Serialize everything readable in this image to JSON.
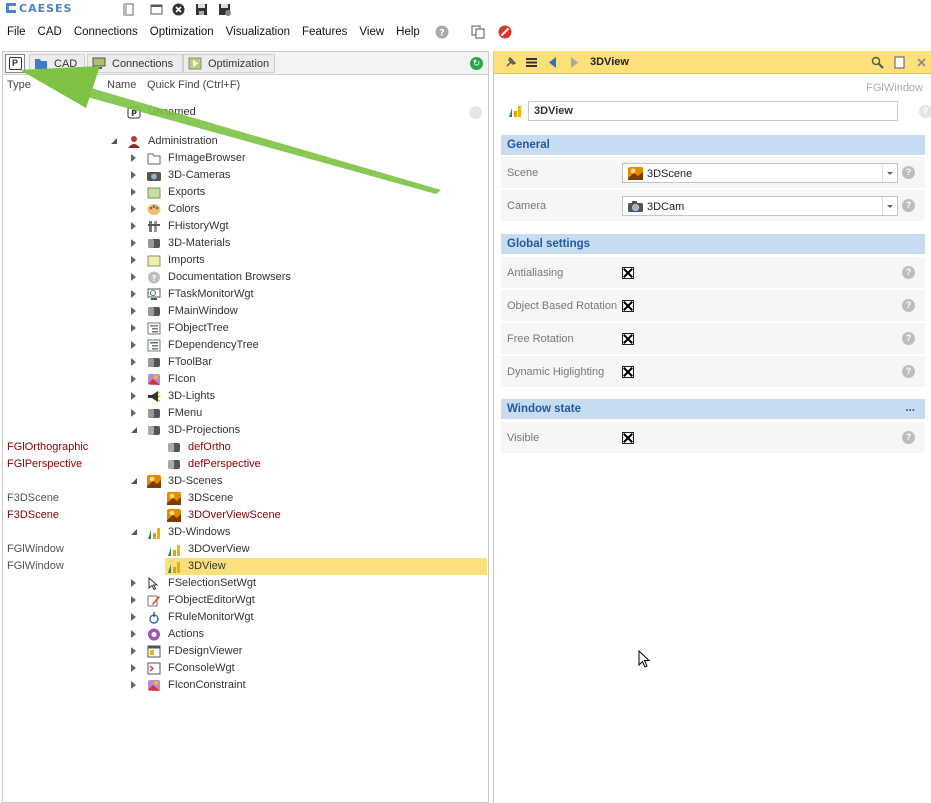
{
  "app": {
    "logo_text": "CAESES"
  },
  "menu": {
    "items": [
      "File",
      "CAD",
      "Connections",
      "Optimization",
      "Visualization",
      "Features",
      "View",
      "Help"
    ]
  },
  "left": {
    "tabs": [
      {
        "label": "P"
      },
      {
        "label": "CAD"
      },
      {
        "label": "Connections"
      },
      {
        "label": "Optimization"
      }
    ],
    "columns": {
      "type": "Type",
      "name": "Name",
      "find_placeholder": "Quick Find (Ctrl+F)"
    },
    "tree": [
      {
        "type": "",
        "label": "Unnamed",
        "level": 0,
        "exp": "none",
        "icon": "project-icon"
      },
      {
        "type": "",
        "label": "Administration",
        "level": 0,
        "exp": "open",
        "icon": "admin-icon"
      },
      {
        "type": "",
        "label": "FImageBrowser",
        "level": 1,
        "exp": "closed",
        "icon": "folder-icon"
      },
      {
        "type": "",
        "label": "3D-Cameras",
        "level": 1,
        "exp": "closed",
        "icon": "camera-icon"
      },
      {
        "type": "",
        "label": "Exports",
        "level": 1,
        "exp": "closed",
        "icon": "export-icon"
      },
      {
        "type": "",
        "label": "Colors",
        "level": 1,
        "exp": "closed",
        "icon": "palette-icon"
      },
      {
        "type": "",
        "label": "FHistoryWgt",
        "level": 1,
        "exp": "closed",
        "icon": "history-icon"
      },
      {
        "type": "",
        "label": "3D-Materials",
        "level": 1,
        "exp": "closed",
        "icon": "material-icon"
      },
      {
        "type": "",
        "label": "Imports",
        "level": 1,
        "exp": "closed",
        "icon": "import-icon"
      },
      {
        "type": "",
        "label": "Documentation Browsers",
        "level": 1,
        "exp": "closed",
        "icon": "help-doc-icon"
      },
      {
        "type": "",
        "label": "FTaskMonitorWgt",
        "level": 1,
        "exp": "closed",
        "icon": "monitor-icon"
      },
      {
        "type": "",
        "label": "FMainWindow",
        "level": 1,
        "exp": "closed",
        "icon": "window-icon"
      },
      {
        "type": "",
        "label": "FObjectTree",
        "level": 1,
        "exp": "closed",
        "icon": "tree-icon"
      },
      {
        "type": "",
        "label": "FDependencyTree",
        "level": 1,
        "exp": "closed",
        "icon": "dependency-icon"
      },
      {
        "type": "",
        "label": "FToolBar",
        "level": 1,
        "exp": "closed",
        "icon": "toolbar-icon"
      },
      {
        "type": "",
        "label": "FIcon",
        "level": 1,
        "exp": "closed",
        "icon": "icon-icon"
      },
      {
        "type": "",
        "label": "3D-Lights",
        "level": 1,
        "exp": "closed",
        "icon": "light-icon"
      },
      {
        "type": "",
        "label": "FMenu",
        "level": 1,
        "exp": "closed",
        "icon": "menu-icon"
      },
      {
        "type": "",
        "label": "3D-Projections",
        "level": 1,
        "exp": "open",
        "icon": "projection-icon"
      },
      {
        "type": "FGlOrthographic",
        "type_red": true,
        "label": "defOrtho",
        "label_red": true,
        "level": 2,
        "exp": "none",
        "icon": "projection-icon"
      },
      {
        "type": "FGlPerspective",
        "type_red": true,
        "label": "defPerspective",
        "label_red": true,
        "level": 2,
        "exp": "none",
        "icon": "projection-icon"
      },
      {
        "type": "",
        "label": "3D-Scenes",
        "level": 1,
        "exp": "open",
        "icon": "scene-icon"
      },
      {
        "type": "F3DScene",
        "label": "3DScene",
        "level": 2,
        "exp": "none",
        "icon": "scene-icon"
      },
      {
        "type": "F3DScene",
        "type_red": true,
        "label": "3DOverViewScene",
        "label_red": true,
        "level": 2,
        "exp": "none",
        "icon": "scene-icon"
      },
      {
        "type": "",
        "label": "3D-Windows",
        "level": 1,
        "exp": "open",
        "icon": "chart-window-icon"
      },
      {
        "type": "FGlWindow",
        "label": "3DOverView",
        "level": 2,
        "exp": "none",
        "icon": "chart-window-icon"
      },
      {
        "type": "FGlWindow",
        "label": "3DView",
        "level": 2,
        "exp": "none",
        "icon": "chart-window-icon",
        "selected": true
      },
      {
        "type": "",
        "label": "FSelectionSetWgt",
        "level": 1,
        "exp": "closed",
        "icon": "cursor-icon"
      },
      {
        "type": "",
        "label": "FObjectEditorWgt",
        "level": 1,
        "exp": "closed",
        "icon": "editor-icon"
      },
      {
        "type": "",
        "label": "FRuleMonitorWgt",
        "level": 1,
        "exp": "closed",
        "icon": "rule-icon"
      },
      {
        "type": "",
        "label": "Actions",
        "level": 1,
        "exp": "closed",
        "icon": "actions-icon"
      },
      {
        "type": "",
        "label": "FDesignViewer",
        "level": 1,
        "exp": "closed",
        "icon": "design-viewer-icon"
      },
      {
        "type": "",
        "label": "FConsoleWgt",
        "level": 1,
        "exp": "closed",
        "icon": "console-icon"
      },
      {
        "type": "",
        "label": "FIconConstraint",
        "level": 1,
        "exp": "closed",
        "icon": "icon-icon"
      }
    ]
  },
  "right": {
    "header_title": "3DView",
    "class_label": "FGlWindow",
    "name_value": "3DView",
    "sections": {
      "general": "General",
      "global": "Global settings",
      "window": "Window state",
      "window_more": "..."
    },
    "props": {
      "scene_label": "Scene",
      "scene_value": "3DScene",
      "camera_label": "Camera",
      "camera_value": "3DCam",
      "antialiasing": "Antialiasing",
      "object_rotation": "Object Based Rotation",
      "free_rotation": "Free Rotation",
      "dynamic_highlighting": "Dynamic Higlighting",
      "visible": "Visible"
    },
    "help_glyph": "?"
  },
  "colors": {
    "accent_yellow": "#fde07a",
    "section_blue": "#c8dcf1",
    "section_text": "#1e5a9c",
    "annotation_green": "#7dc242",
    "red_type": "#8b0000"
  }
}
